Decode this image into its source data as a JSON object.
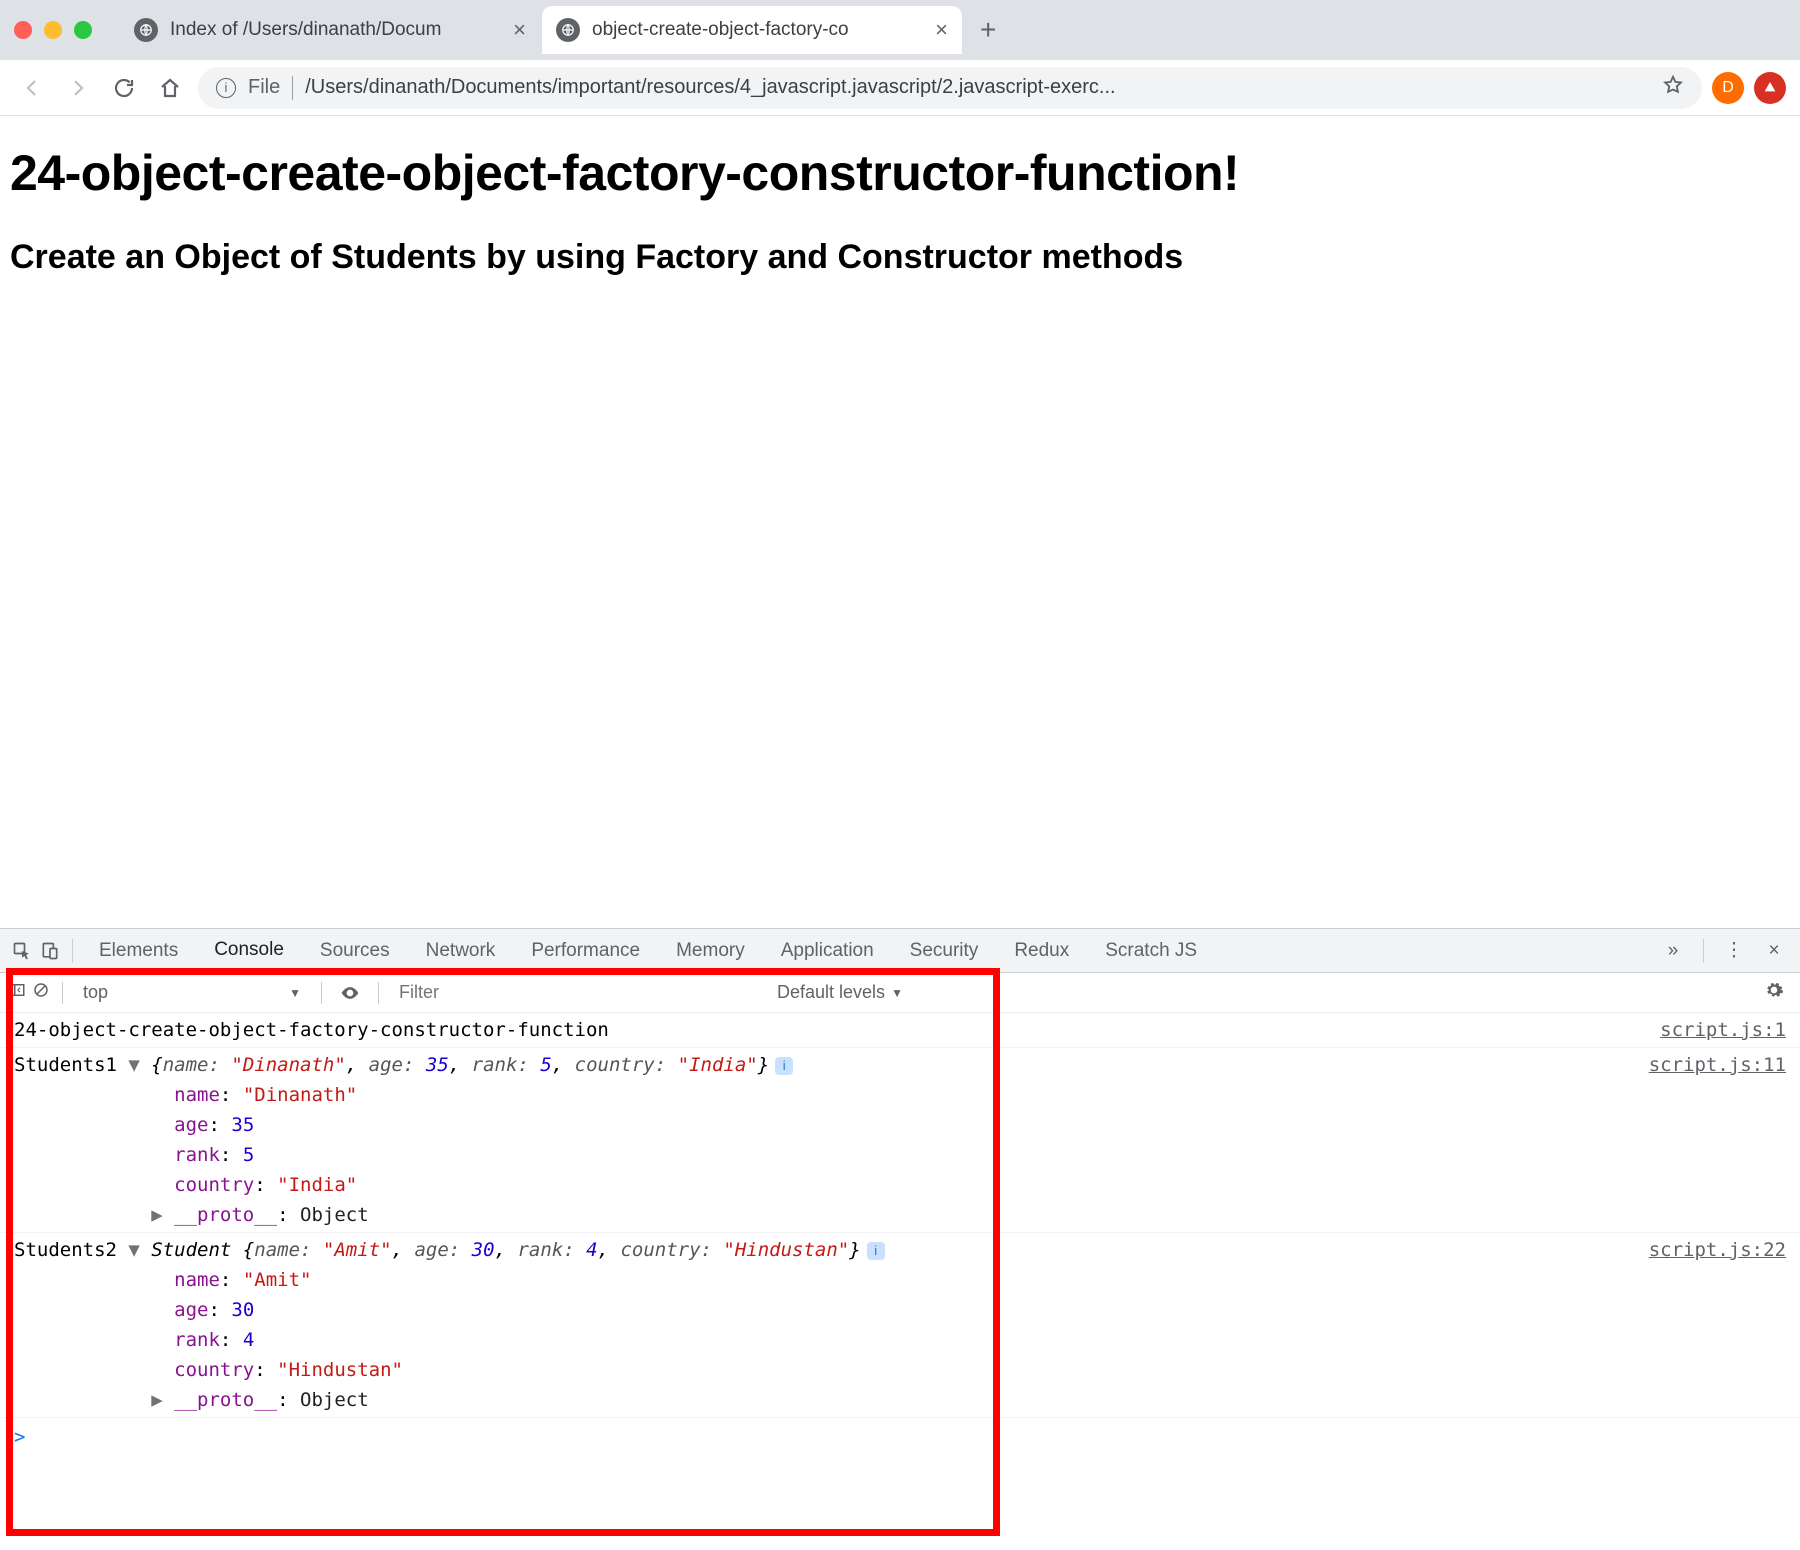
{
  "browser": {
    "tabs": [
      {
        "title": "Index of /Users/dinanath/Docum",
        "active": false
      },
      {
        "title": "object-create-object-factory-co",
        "active": true
      }
    ],
    "omnibox": {
      "scheme_label": "File",
      "url": "/Users/dinanath/Documents/important/resources/4_javascript.javascript/2.javascript-exerc..."
    },
    "avatar_initial": "D"
  },
  "page": {
    "h1": "24-object-create-object-factory-constructor-function!",
    "h2": "Create an Object of Students by using Factory and Constructor methods"
  },
  "devtools": {
    "tabs": [
      "Elements",
      "Console",
      "Sources",
      "Network",
      "Performance",
      "Memory",
      "Application",
      "Security",
      "Redux",
      "Scratch JS"
    ],
    "active_tab": "Console",
    "overflow_glyph": "»",
    "console_bar": {
      "context": "top",
      "filter_placeholder": "Filter",
      "levels_label": "Default levels"
    },
    "logs": [
      {
        "source": "script.js:1",
        "text": "24-object-create-object-factory-constructor-function"
      },
      {
        "source": "script.js:11",
        "prefix": "Students1",
        "class_name": "",
        "summary": {
          "name": "Dinanath",
          "age": 35,
          "rank": 5,
          "country": "India"
        },
        "expanded": {
          "name": "\"Dinanath\"",
          "age": "35",
          "rank": "5",
          "country": "\"India\"",
          "__proto__": "Object"
        }
      },
      {
        "source": "script.js:22",
        "prefix": "Students2",
        "class_name": "Student",
        "summary": {
          "name": "Amit",
          "age": 30,
          "rank": 4,
          "country": "Hindustan"
        },
        "expanded": {
          "name": "\"Amit\"",
          "age": "30",
          "rank": "4",
          "country": "\"Hindustan\"",
          "__proto__": "Object"
        }
      }
    ]
  }
}
